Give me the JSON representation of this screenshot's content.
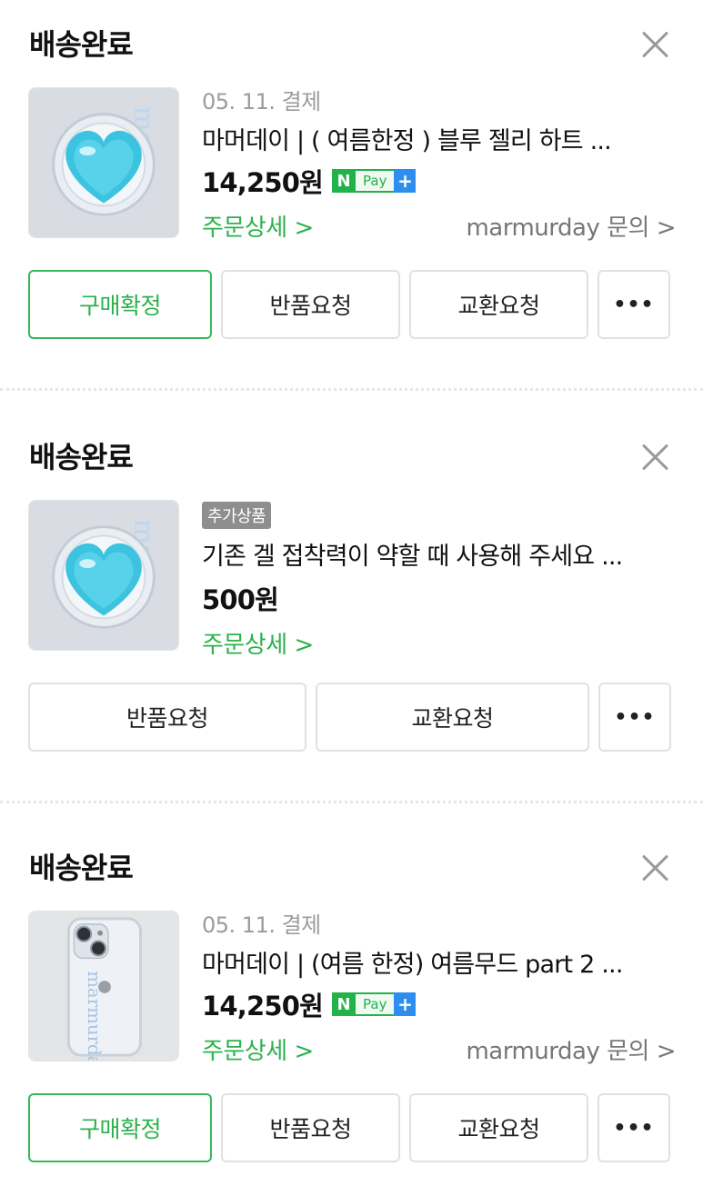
{
  "orders": [
    {
      "status": "배송완료",
      "date": "05. 11. 결제",
      "product_name": "마머데이 | ( 여름한정 ) 블루 젤리 하트 ...",
      "price": "14,250원",
      "pay_label": "Pay",
      "pay_n": "N",
      "pay_plus": "+",
      "detail_link": "주문상세 >",
      "inquiry_link": "marmurday 문의 >",
      "buttons": [
        "구매확정",
        "반품요청",
        "교환요청"
      ],
      "more": "•••"
    },
    {
      "status": "배송완료",
      "badge": "추가상품",
      "product_name": "기존 겔 접착력이 약할 때 사용해 주세요 ...",
      "price": "500원",
      "detail_link": "주문상세 >",
      "buttons": [
        "반품요청",
        "교환요청"
      ],
      "more": "•••"
    },
    {
      "status": "배송완료",
      "date": "05. 11. 결제",
      "product_name": "마머데이 | (여름 한정) 여름무드 part 2 ...",
      "price": "14,250원",
      "pay_label": "Pay",
      "pay_n": "N",
      "pay_plus": "+",
      "detail_link": "주문상세 >",
      "inquiry_link": "marmurday 문의 >",
      "buttons": [
        "구매확정",
        "반품요청",
        "교환요청"
      ],
      "more": "•••"
    }
  ],
  "thumbnail_watermark": "marmurday",
  "colors": {
    "accent_green": "#2bb24c",
    "pay_blue": "#2d8ef0",
    "muted_gray": "#9c9c9c",
    "border_gray": "#e1e1e1"
  }
}
